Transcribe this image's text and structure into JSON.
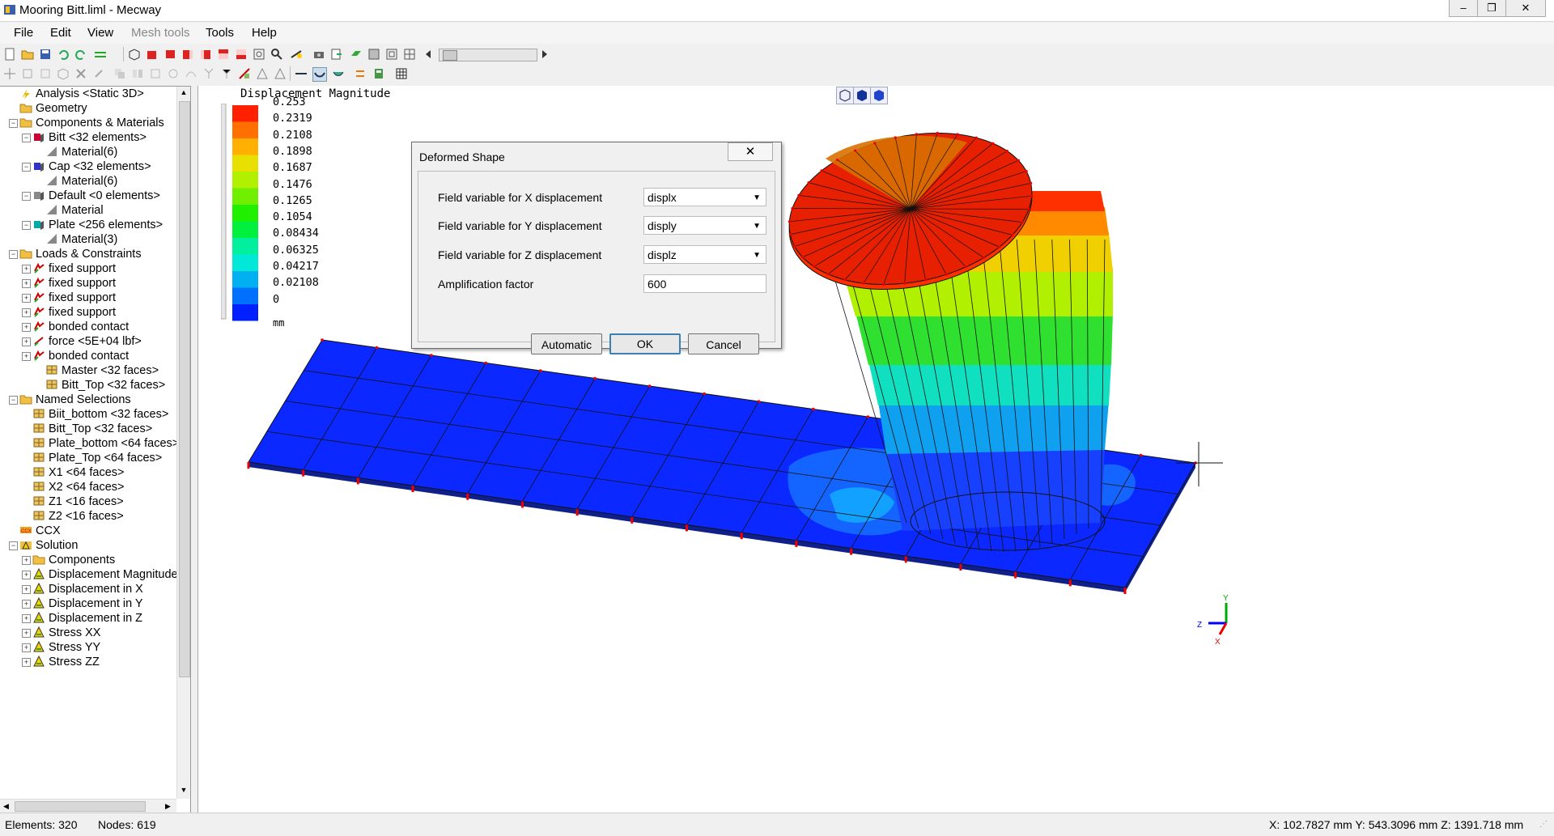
{
  "window": {
    "title": "Mooring Bitt.liml - Mecway"
  },
  "menu": [
    "File",
    "Edit",
    "View",
    "Mesh tools",
    "Tools",
    "Help"
  ],
  "tree": [
    {
      "label": "Analysis <Static 3D>",
      "icon": "analysis-icon",
      "level": 0
    },
    {
      "label": "Geometry",
      "icon": "folder-icon",
      "level": 0
    },
    {
      "label": "Components & Materials",
      "icon": "folder-icon",
      "level": 0
    },
    {
      "label": "Bitt <32 elements>",
      "icon": "component-icon",
      "level": 1,
      "color": "#c03"
    },
    {
      "label": "Material(6)",
      "icon": "material-icon",
      "level": 2
    },
    {
      "label": "Cap <32 elements>",
      "icon": "component-icon",
      "level": 1,
      "color": "#33c"
    },
    {
      "label": "Material(6)",
      "icon": "material-icon",
      "level": 2
    },
    {
      "label": "Default <0 elements>",
      "icon": "component-icon",
      "level": 1,
      "color": "#888"
    },
    {
      "label": "Material",
      "icon": "material-icon",
      "level": 2
    },
    {
      "label": "Plate <256 elements>",
      "icon": "component-icon",
      "level": 1,
      "color": "#0aa"
    },
    {
      "label": "Material(3)",
      "icon": "material-icon",
      "level": 2
    },
    {
      "label": "Loads & Constraints",
      "icon": "folder-icon",
      "level": 0
    },
    {
      "label": "fixed support",
      "icon": "constraint-icon",
      "level": 1
    },
    {
      "label": "fixed support",
      "icon": "constraint-icon",
      "level": 1
    },
    {
      "label": "fixed support",
      "icon": "constraint-icon",
      "level": 1
    },
    {
      "label": "fixed support",
      "icon": "constraint-icon",
      "level": 1
    },
    {
      "label": "bonded contact",
      "icon": "constraint-icon",
      "level": 1
    },
    {
      "label": "force <5E+04 lbf>",
      "icon": "force-icon",
      "level": 1
    },
    {
      "label": "bonded contact",
      "icon": "constraint-icon",
      "level": 1
    },
    {
      "label": "Master <32 faces>",
      "icon": "face-set-icon",
      "level": 2
    },
    {
      "label": "Bitt_Top <32 faces>",
      "icon": "face-set-icon",
      "level": 2
    },
    {
      "label": "Named Selections",
      "icon": "folder-icon",
      "level": 0
    },
    {
      "label": "Biit_bottom <32 faces>",
      "icon": "face-set-icon",
      "level": 1
    },
    {
      "label": "Bitt_Top <32 faces>",
      "icon": "face-set-icon",
      "level": 1
    },
    {
      "label": "Plate_bottom <64 faces>",
      "icon": "face-set-icon",
      "level": 1
    },
    {
      "label": "Plate_Top <64 faces>",
      "icon": "face-set-icon",
      "level": 1
    },
    {
      "label": "X1 <64 faces>",
      "icon": "face-set-icon",
      "level": 1
    },
    {
      "label": "X2 <64 faces>",
      "icon": "face-set-icon",
      "level": 1
    },
    {
      "label": "Z1 <16 faces>",
      "icon": "face-set-icon",
      "level": 1
    },
    {
      "label": "Z2 <16 faces>",
      "icon": "face-set-icon",
      "level": 1
    },
    {
      "label": "CCX",
      "icon": "ccx-icon",
      "level": 0
    },
    {
      "label": "Solution",
      "icon": "solution-icon",
      "level": 0
    },
    {
      "label": "Components",
      "icon": "folder-icon",
      "level": 1
    },
    {
      "label": "Displacement Magnitude",
      "icon": "result-icon",
      "level": 1
    },
    {
      "label": "Displacement in X",
      "icon": "result-icon",
      "level": 1
    },
    {
      "label": "Displacement in Y",
      "icon": "result-icon",
      "level": 1
    },
    {
      "label": "Displacement in Z",
      "icon": "result-icon",
      "level": 1
    },
    {
      "label": "Stress XX",
      "icon": "result-icon",
      "level": 1
    },
    {
      "label": "Stress YY",
      "icon": "result-icon",
      "level": 1
    },
    {
      "label": "Stress ZZ",
      "icon": "result-icon",
      "level": 1
    }
  ],
  "legend": {
    "title": "Displacement Magnitude",
    "unit": "mm",
    "values": [
      "0.253",
      "0.2319",
      "0.2108",
      "0.1898",
      "0.1687",
      "0.1476",
      "0.1265",
      "0.1054",
      "0.08434",
      "0.06325",
      "0.04217",
      "0.02108",
      "0"
    ],
    "colors": [
      "#ff2000",
      "#ff7000",
      "#ffb000",
      "#e8e000",
      "#b0f000",
      "#70f000",
      "#20f000",
      "#00f040",
      "#00f0a0",
      "#00e8d8",
      "#00b0f0",
      "#0070ff",
      "#0020ff"
    ]
  },
  "dialog": {
    "title": "Deformed Shape",
    "close_symbol": "✕",
    "x_label": "Field variable for X displacement",
    "x_value": "displx",
    "y_label": "Field variable for Y displacement",
    "y_value": "disply",
    "z_label": "Field variable for Z displacement",
    "z_value": "displz",
    "amp_label": "Amplification factor",
    "amp_value": "600",
    "automatic": "Automatic",
    "ok": "OK",
    "cancel": "Cancel"
  },
  "status": {
    "elements": "Elements:  320",
    "nodes": "Nodes: 619",
    "coords": "X: 102.7827 mm Y: 543.3096 mm Z: 1391.718 mm"
  },
  "axis_labels": {
    "x": "X",
    "y": "Y",
    "z": "Z"
  }
}
